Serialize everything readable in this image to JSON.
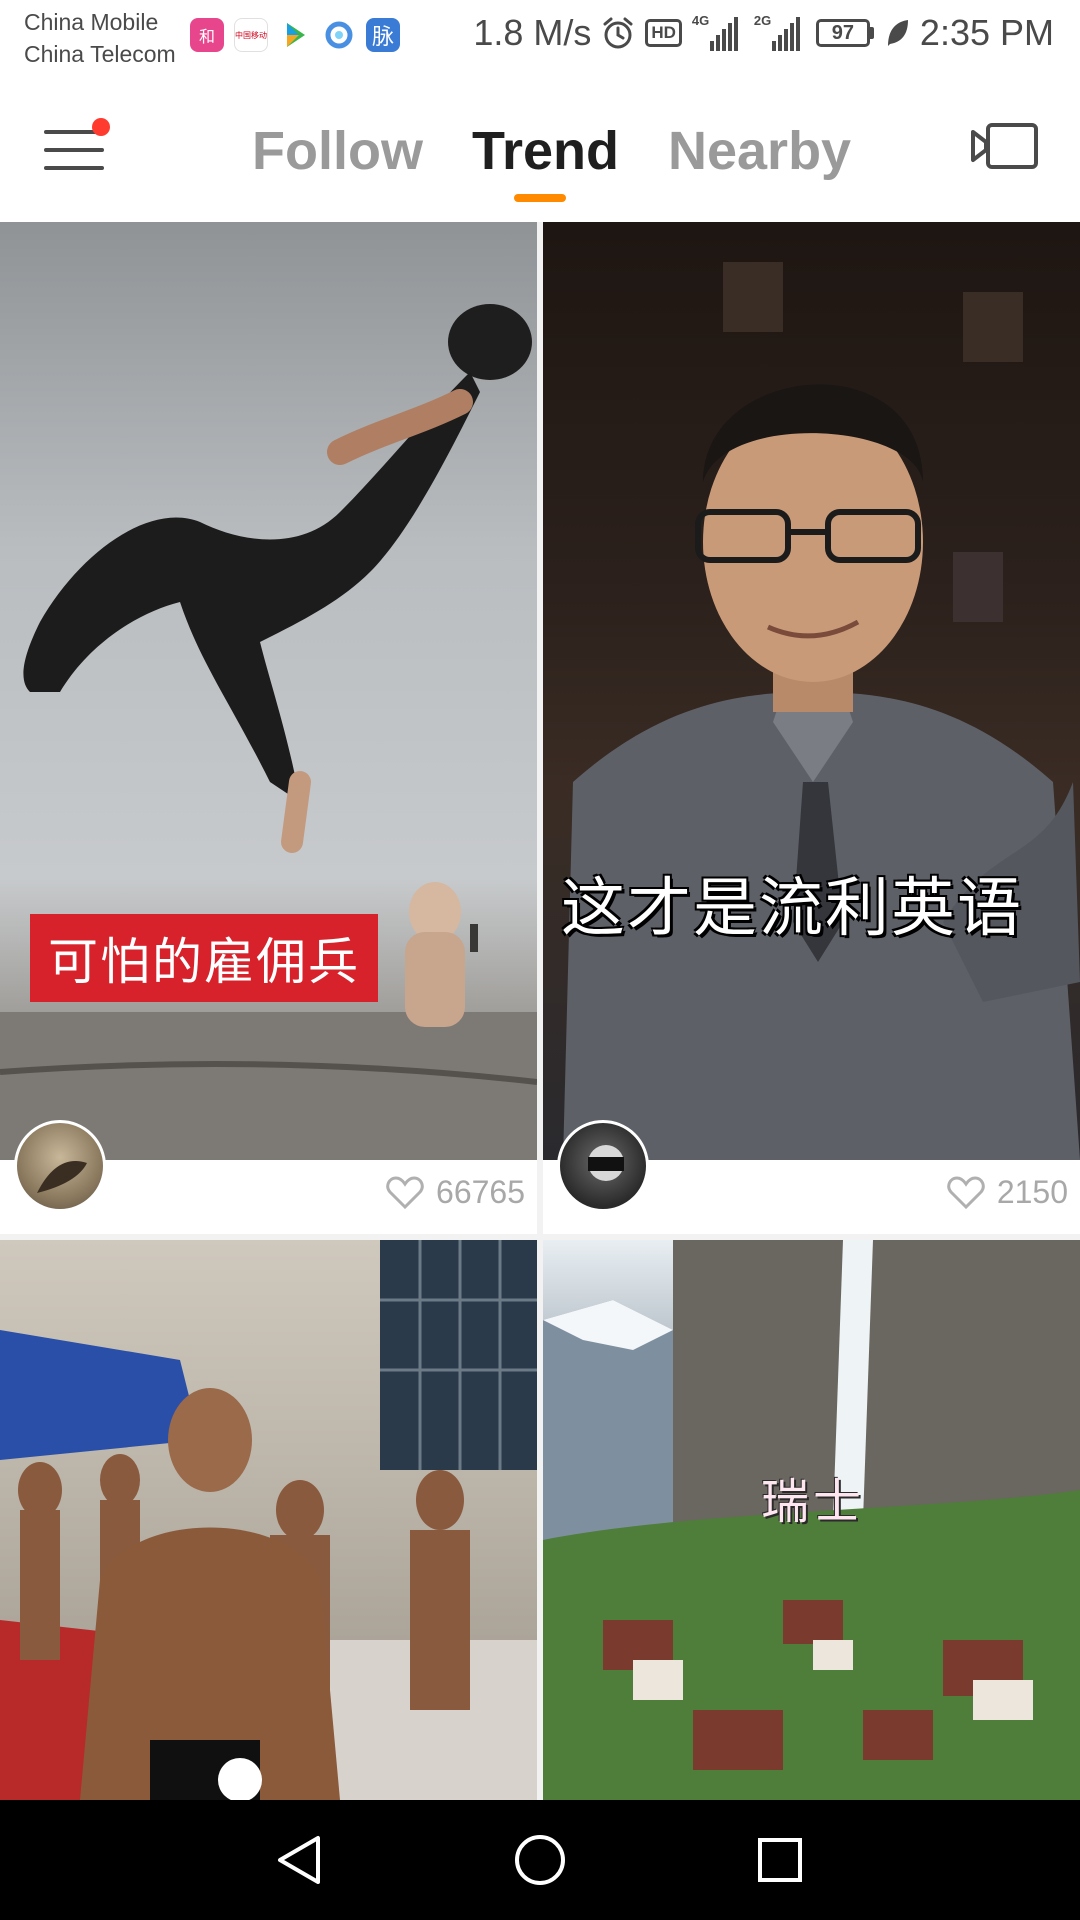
{
  "status_bar": {
    "carrier_1": "China Mobile",
    "carrier_2": "China Telecom",
    "network_speed": "1.8 M/s",
    "hd_label": "HD",
    "signal_1_tag": "4G",
    "signal_2_tag": "2G",
    "battery_level": "97",
    "time": "2:35 PM",
    "app_icons": [
      "app-icon-pink",
      "china-mobile-app-icon",
      "video-app-icon",
      "browser-app-icon",
      "maimai-app-icon"
    ],
    "app_icon_chars": {
      "pink": "和",
      "china_mobile": "中国移动",
      "maimai": "脉"
    }
  },
  "top_nav": {
    "tabs": [
      {
        "label": "Follow",
        "active": false
      },
      {
        "label": "Trend",
        "active": true
      },
      {
        "label": "Nearby",
        "active": false
      }
    ],
    "menu_has_notification": true,
    "accent_color": "#ff8a00"
  },
  "feed": {
    "cards": [
      {
        "caption": "可怕的雇佣兵",
        "likes": "66765"
      },
      {
        "caption": "这才是流利英语",
        "likes": "2150"
      },
      {
        "caption": "",
        "likes": null
      },
      {
        "caption": "瑞士",
        "likes": null
      }
    ]
  },
  "nav_bar": {
    "buttons": [
      "back-icon",
      "home-icon",
      "recents-icon"
    ]
  }
}
